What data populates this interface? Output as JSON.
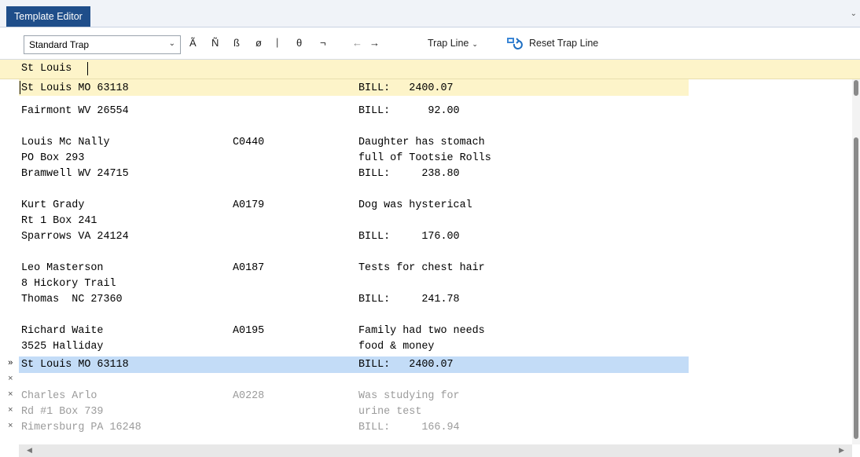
{
  "tab": {
    "title": "Template Editor"
  },
  "toolbar": {
    "mode_value": "Standard Trap",
    "chars": [
      "Ã",
      "Ñ",
      "ß",
      "ø"
    ],
    "separator": "|",
    "symbols": [
      "θ",
      "¬"
    ],
    "arrows": [
      "←",
      "→"
    ],
    "trap_line_label": "Trap Line",
    "reset_label": "Reset Trap Line"
  },
  "input": {
    "value": "St Louis"
  },
  "rows": [
    {
      "c1": "St Louis MO 63118",
      "c2": "",
      "c3": "BILL:   2400.07"
    },
    {
      "c1": "Fairmont WV 26554",
      "c2": "",
      "c3": "BILL:      92.00"
    },
    {
      "c1": "",
      "c2": "",
      "c3": ""
    },
    {
      "c1": "Louis Mc Nally",
      "c2": "C0440",
      "c3": "Daughter has stomach"
    },
    {
      "c1": "PO Box 293",
      "c2": "",
      "c3": "full of Tootsie Rolls"
    },
    {
      "c1": "Bramwell WV 24715",
      "c2": "",
      "c3": "BILL:     238.80"
    },
    {
      "c1": "",
      "c2": "",
      "c3": ""
    },
    {
      "c1": "Kurt Grady",
      "c2": "A0179",
      "c3": "Dog was hysterical"
    },
    {
      "c1": "Rt 1 Box 241",
      "c2": "",
      "c3": ""
    },
    {
      "c1": "Sparrows VA 24124",
      "c2": "",
      "c3": "BILL:     176.00"
    },
    {
      "c1": "",
      "c2": "",
      "c3": ""
    },
    {
      "c1": "Leo Masterson",
      "c2": "A0187",
      "c3": "Tests for chest hair"
    },
    {
      "c1": "8 Hickory Trail",
      "c2": "",
      "c3": ""
    },
    {
      "c1": "Thomas  NC 27360",
      "c2": "",
      "c3": "BILL:     241.78"
    },
    {
      "c1": "",
      "c2": "",
      "c3": ""
    },
    {
      "c1": "Richard Waite",
      "c2": "A0195",
      "c3": "Family had two needs"
    },
    {
      "c1": "3525 Halliday",
      "c2": "",
      "c3": "food & money"
    },
    {
      "c1": "St Louis MO 63118",
      "c2": "",
      "c3": "BILL:   2400.07"
    },
    {
      "c1": "",
      "c2": "",
      "c3": ""
    },
    {
      "c1": "Charles Arlo",
      "c2": "A0228",
      "c3": "Was studying for"
    },
    {
      "c1": "Rd #1 Box 739",
      "c2": "",
      "c3": "urine test"
    },
    {
      "c1": "Rimersburg PA 16248",
      "c2": "",
      "c3": "BILL:     166.94"
    }
  ],
  "gutter": {
    "current_marker": "»",
    "excluded_marker": "×"
  }
}
